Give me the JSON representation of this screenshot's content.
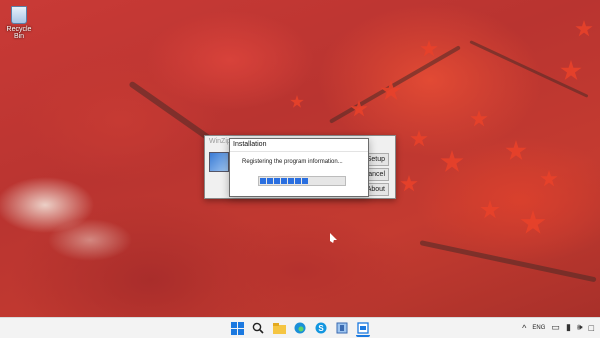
{
  "desktop": {
    "recycle_bin_label": "Recycle Bin"
  },
  "back_dialog": {
    "title": "WinZip Se",
    "product_label": "W",
    "buttons": [
      "Setup",
      "Cancel",
      "About"
    ]
  },
  "install_dialog": {
    "title": "Installation",
    "message": "Registering the program information...",
    "progress_segments": 7
  },
  "taskbar": {
    "icons": [
      "windows-start-icon",
      "search-icon",
      "file-explorer-icon",
      "edge-icon",
      "skype-icon",
      "winzip-setup-icon",
      "installation-window-icon"
    ],
    "tray": {
      "chevron": "^",
      "language": "ENG"
    }
  },
  "colors": {
    "accent": "#1b79e0",
    "progress": "#2a6fe0",
    "taskbar": "#f3f3f3"
  }
}
